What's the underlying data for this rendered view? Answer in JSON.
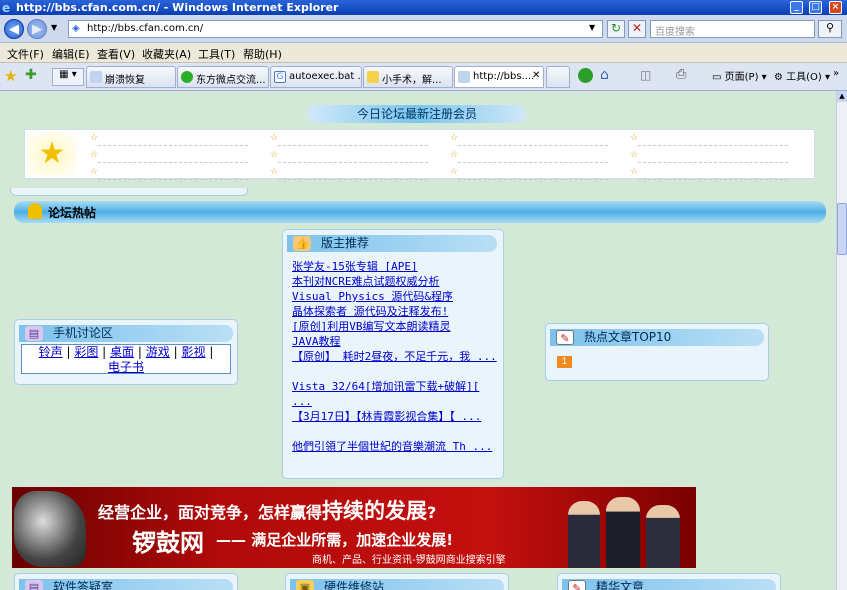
{
  "window": {
    "title": "http://bbs.cfan.com.cn/ - Windows Internet Explorer",
    "min_label": "_",
    "max_label": "□",
    "close_label": "×"
  },
  "address": {
    "url": "http://bbs.cfan.com.cn/",
    "search_placeholder": "百度搜索"
  },
  "menu": [
    "文件(F)",
    "编辑(E)",
    "查看(V)",
    "收藏夹(A)",
    "工具(T)",
    "帮助(H)"
  ],
  "tabs": [
    {
      "label": "崩溃恢复",
      "icon": "page-icon"
    },
    {
      "label": "东方微点交流...",
      "icon": "green-circle-icon"
    },
    {
      "label": "autoexec.bat ...",
      "icon": "google-g-icon"
    },
    {
      "label": "小手术，解...",
      "icon": "star-page-icon"
    },
    {
      "label": "http://bbs....",
      "icon": "page-icon",
      "active": true
    }
  ],
  "toolbar": {
    "page_label": "页面(P)",
    "tools_label": "工具(O)"
  },
  "page": {
    "new_members_title": "今日论坛最新注册会员",
    "hot_title": "论坛热帖",
    "mod_box": {
      "title": "版主推荐",
      "links": [
        "张学友-15张专辑 [APE]",
        "本刊对NCRE难点试题权威分析",
        "Visual Physics 源代码&程序",
        "晶体探索者 源代码及注释发布!",
        "[原创]利用VB编写文本朗读精灵",
        "JAVA教程",
        "【原创】 耗时2昼夜，不足千元，我 ...",
        "Vista 32/64[增加讯雷下载+破解][ ...",
        "【3月17日】【林青霞影视合集】【 ...",
        "他們引領了半個世紀的音樂潮流 Th ..."
      ]
    },
    "phone_box": {
      "title": "手机讨论区",
      "links": [
        "铃声",
        "彩图",
        "桌面",
        "游戏",
        "影视",
        "电子书"
      ],
      "sep": "|"
    },
    "hot_box": {
      "title": "热点文章TOP10",
      "rank": "1"
    },
    "banner": {
      "line1": "经营企业，面对竞争，怎样赢得",
      "line1_big": "持续的发展",
      "line1_q": "?",
      "brand": "锣鼓网",
      "slogan": "—— 满足企业所需，加速企业发展!",
      "footer": "商机、产品、行业资讯-锣鼓网商业搜索引擎"
    },
    "bottom_boxes": [
      "软件答疑室",
      "硬件维修站",
      "精华文章"
    ]
  }
}
